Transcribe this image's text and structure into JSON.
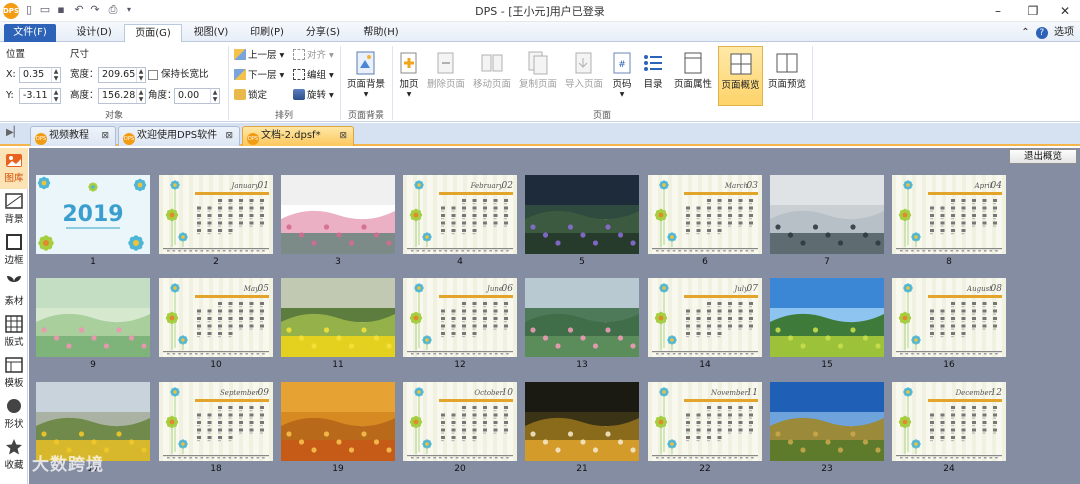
{
  "app": {
    "logo_text": "DPS",
    "title": "DPS - [王小元]用户已登录"
  },
  "menu": {
    "tabs": [
      "文件(F)",
      "设计(D)",
      "页面(G)",
      "视图(V)",
      "印刷(P)",
      "分享(S)",
      "帮助(H)"
    ],
    "active": "页面(G)",
    "options_label": "选项"
  },
  "ribbon": {
    "object_group": {
      "label": "对象",
      "position_label": "位置",
      "size_label": "尺寸",
      "x_label": "X:",
      "y_label": "Y:",
      "x_value": "0.35",
      "y_value": "-3.11",
      "width_label": "宽度：",
      "height_label": "高度：",
      "width_value": "209.65",
      "height_value": "156.28",
      "keep_ratio_label": "保持长宽比",
      "keep_ratio_checked": false,
      "angle_label": "角度：",
      "angle_value": "0.00"
    },
    "arrange_group": {
      "label": "排列",
      "bring_up": "上一层",
      "send_down": "下一层",
      "lock": "锁定",
      "align": "对齐",
      "group": "编组",
      "rotate": "旋转"
    },
    "bg_group": {
      "label": "页面背景",
      "button": "页面背景"
    },
    "page_group": {
      "label": "页面",
      "buttons": [
        {
          "label": "加页",
          "enabled": true,
          "dropdown": true
        },
        {
          "label": "删除页面",
          "enabled": false
        },
        {
          "label": "移动页面",
          "enabled": false
        },
        {
          "label": "复制页面",
          "enabled": false
        },
        {
          "label": "导入页面",
          "enabled": false
        },
        {
          "label": "页码",
          "enabled": true,
          "dropdown": true
        },
        {
          "label": "目录",
          "enabled": true
        },
        {
          "label": "页面属性",
          "enabled": true
        },
        {
          "label": "页面概览",
          "enabled": true,
          "selected": true
        },
        {
          "label": "页面预览",
          "enabled": true
        }
      ]
    }
  },
  "doc_tabs": [
    {
      "label": "视频教程",
      "active": false
    },
    {
      "label": "欢迎使用DPS软件",
      "active": false
    },
    {
      "label": "文档-2.dpsf*",
      "active": true
    }
  ],
  "sidebar": {
    "items": [
      {
        "label": "图库",
        "active": true
      },
      {
        "label": "背景",
        "active": false
      },
      {
        "label": "边框",
        "active": false
      },
      {
        "label": "素材",
        "active": false
      },
      {
        "label": "版式",
        "active": false
      },
      {
        "label": "模板",
        "active": false
      },
      {
        "label": "形状",
        "active": false
      },
      {
        "label": "收藏",
        "active": false
      }
    ]
  },
  "overview": {
    "exit_button": "退出概览",
    "pages": [
      {
        "num": "1",
        "kind": "cover",
        "text": "2019"
      },
      {
        "num": "2",
        "kind": "calendar",
        "month": "January",
        "mnum": "01"
      },
      {
        "num": "3",
        "kind": "photo",
        "scene": "blossom"
      },
      {
        "num": "4",
        "kind": "calendar",
        "month": "February",
        "mnum": "02"
      },
      {
        "num": "5",
        "kind": "photo",
        "scene": "purple"
      },
      {
        "num": "6",
        "kind": "calendar",
        "month": "March",
        "mnum": "03"
      },
      {
        "num": "7",
        "kind": "photo",
        "scene": "lake"
      },
      {
        "num": "8",
        "kind": "calendar",
        "month": "April",
        "mnum": "04"
      },
      {
        "num": "9",
        "kind": "photo",
        "scene": "pink"
      },
      {
        "num": "10",
        "kind": "calendar",
        "month": "May",
        "mnum": "05"
      },
      {
        "num": "11",
        "kind": "photo",
        "scene": "canola"
      },
      {
        "num": "12",
        "kind": "calendar",
        "month": "June",
        "mnum": "06"
      },
      {
        "num": "13",
        "kind": "photo",
        "scene": "lotus"
      },
      {
        "num": "14",
        "kind": "calendar",
        "month": "July",
        "mnum": "07"
      },
      {
        "num": "15",
        "kind": "photo",
        "scene": "meadow"
      },
      {
        "num": "16",
        "kind": "calendar",
        "month": "August",
        "mnum": "08"
      },
      {
        "num": "17",
        "kind": "photo",
        "scene": "sunflower"
      },
      {
        "num": "18",
        "kind": "calendar",
        "month": "September",
        "mnum": "09"
      },
      {
        "num": "19",
        "kind": "photo",
        "scene": "autumn"
      },
      {
        "num": "20",
        "kind": "calendar",
        "month": "October",
        "mnum": "10"
      },
      {
        "num": "21",
        "kind": "photo",
        "scene": "reed"
      },
      {
        "num": "22",
        "kind": "calendar",
        "month": "November",
        "mnum": "11"
      },
      {
        "num": "23",
        "kind": "photo",
        "scene": "hills"
      },
      {
        "num": "24",
        "kind": "calendar",
        "month": "December",
        "mnum": "12"
      }
    ]
  },
  "watermark": "大数跨境"
}
